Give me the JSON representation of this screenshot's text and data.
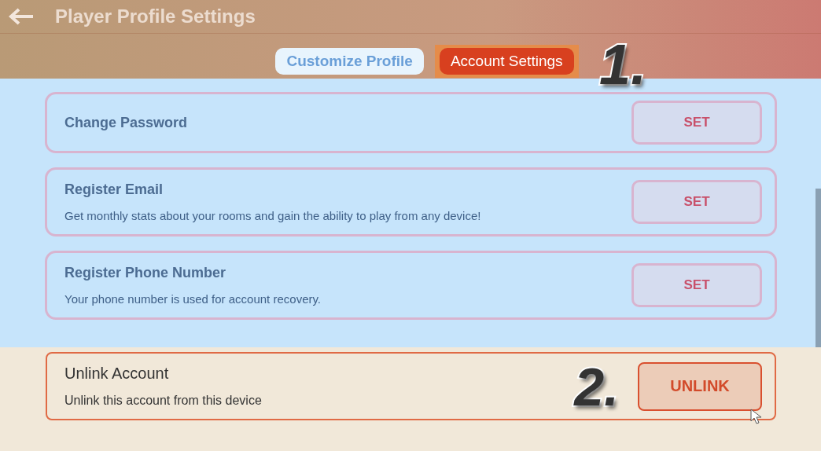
{
  "window": {
    "title": "Player Profile Settings"
  },
  "tabs": [
    {
      "label": "Customize Profile",
      "selected": false
    },
    {
      "label": "Account Settings",
      "selected": true
    }
  ],
  "settings": [
    {
      "title": "Change Password",
      "button": "SET",
      "highlighted": false
    },
    {
      "title": "Register Email",
      "description": "Get monthly stats about your rooms and gain the ability to play from any device!",
      "button": "SET",
      "highlighted": false
    },
    {
      "title": "Register Phone Number",
      "description": "Your phone number is used for account recovery.",
      "button": "SET",
      "highlighted": false
    },
    {
      "title": "Unlink Account",
      "description": "Unlink this account from this device",
      "button": "UNLINK",
      "highlighted": true
    }
  ],
  "annotations": [
    "1.",
    "2."
  ]
}
